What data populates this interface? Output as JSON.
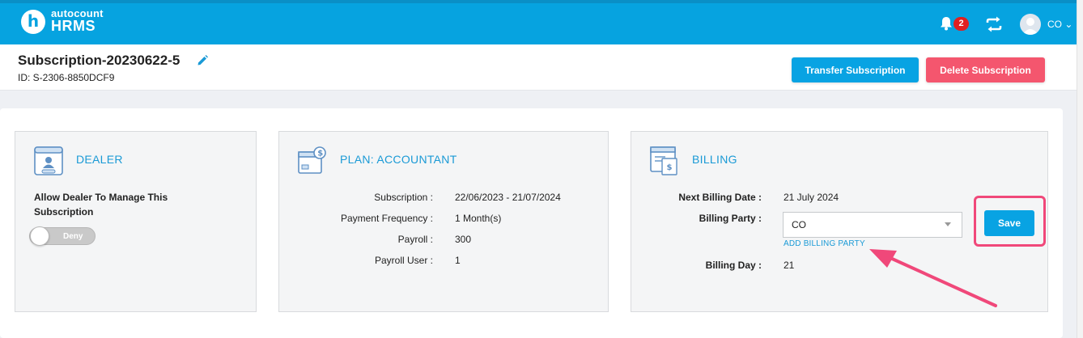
{
  "app": {
    "logo_letter": "h",
    "logo_top": "autocount",
    "logo_bottom": "HRMS",
    "notification_count": "2",
    "user_initials": "CO"
  },
  "header": {
    "title": "Subscription-20230622-5",
    "id": "ID: S-2306-8850DCF9",
    "transfer_label": "Transfer Subscription",
    "delete_label": "Delete Subscription"
  },
  "dealer": {
    "title": "DEALER",
    "allow_text": "Allow Dealer To Manage This Subscription",
    "toggle_label": "Deny"
  },
  "plan": {
    "title": "PLAN: ACCOUNTANT",
    "rows": [
      {
        "label": "Subscription :",
        "value": "22/06/2023 - 21/07/2024"
      },
      {
        "label": "Payment Frequency :",
        "value": "1 Month(s)"
      },
      {
        "label": "Payroll :",
        "value": "300"
      },
      {
        "label": "Payroll User :",
        "value": "1"
      }
    ]
  },
  "billing": {
    "title": "BILLING",
    "next_label": "Next Billing Date :",
    "next_value": "21 July 2024",
    "party_label": "Billing Party :",
    "party_value": "CO",
    "add_party": "ADD BILLING PARTY",
    "day_label": "Billing Day :",
    "day_value": "21",
    "save_label": "Save"
  },
  "colors": {
    "topbar": "#06a3e0",
    "primary": "#08a3e3",
    "danger": "#f4566e",
    "highlight": "#f0487a"
  }
}
